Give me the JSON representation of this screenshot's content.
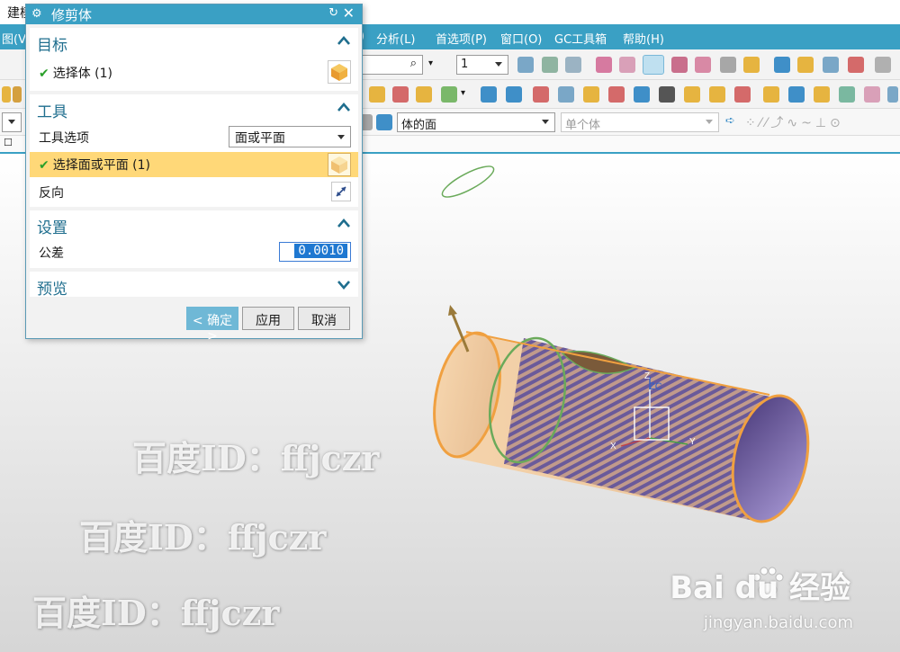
{
  "app": {
    "title": "建模"
  },
  "menubar": {
    "left_partial": "图(V)",
    "paren_partial": ")",
    "items": [
      "分析(L)",
      "首选项(P)",
      "窗口(O)",
      "GC工具箱",
      "帮助(H)"
    ]
  },
  "toolbar": {
    "search_icon": "search-icon",
    "layer_value": "1",
    "filter_value": "体的面",
    "scope_value": "单个体",
    "left_combo_value": ""
  },
  "dialog": {
    "title": "修剪体",
    "gear_icon": "gear-icon",
    "reset_glyph": "↻",
    "close_glyph": "✕",
    "sections": {
      "target": {
        "label": "目标",
        "select_body": "选择体 (1)"
      },
      "tool": {
        "label": "工具",
        "tool_option_label": "工具选项",
        "tool_option_value": "面或平面",
        "select_face": "选择面或平面 (1)",
        "reverse_label": "反向"
      },
      "settings": {
        "label": "设置",
        "tolerance_label": "公差",
        "tolerance_value": "0.0010"
      },
      "preview": {
        "label": "预览"
      }
    },
    "buttons": {
      "ok": "< 确定 >",
      "apply": "应用",
      "cancel": "取消"
    },
    "check_glyph": "✔"
  },
  "viewport": {
    "axis_labels": {
      "zc": "ZC",
      "z": "Z",
      "x": "X",
      "y": "Y"
    },
    "watermarks": [
      "百度ID：ffjczr",
      "百度ID：ffjczr",
      "百度ID：ffjczr"
    ],
    "brand": "Bai du 经验",
    "brand_url": "jingyan.baidu.com"
  },
  "colors": {
    "accent": "#3aa0c4",
    "selected_row": "#ffd878",
    "section_title": "#1f6e8e"
  }
}
